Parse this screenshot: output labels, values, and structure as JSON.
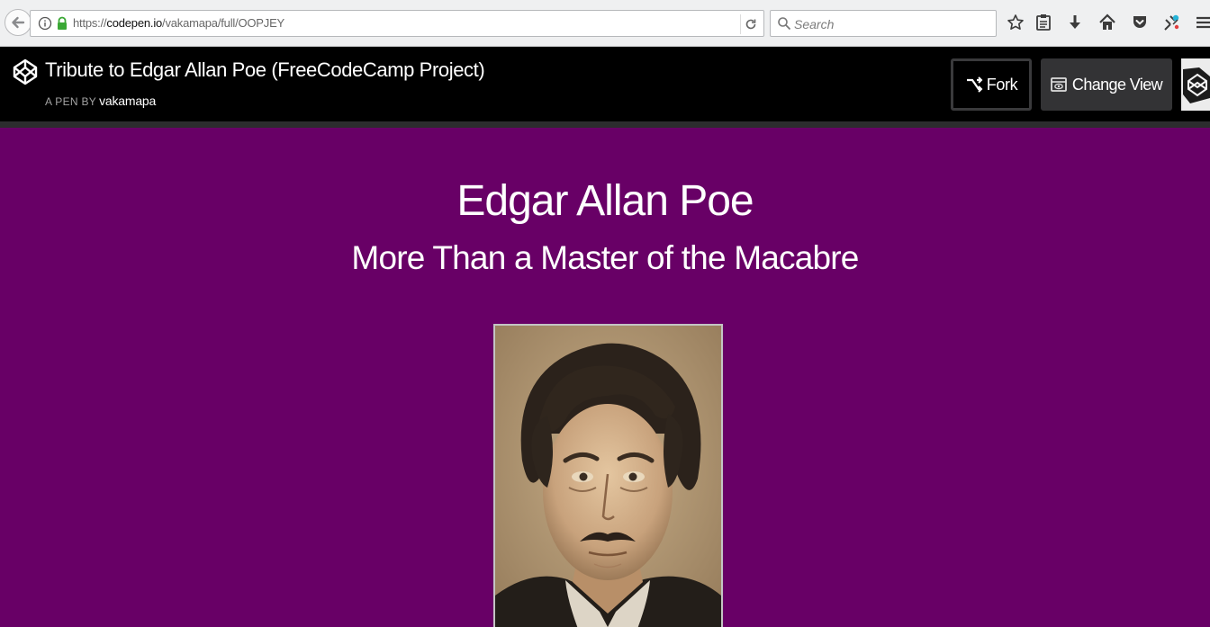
{
  "browser": {
    "url_prefix": "https://",
    "url_domain": "codepen.io",
    "url_path": "/vakamapa/full/OOPJEY",
    "search_placeholder": "Search",
    "toolbar_icons": [
      "bookmark-star-icon",
      "reading-list-icon",
      "download-icon",
      "home-icon",
      "pocket-icon",
      "extension-icon",
      "menu-icon"
    ]
  },
  "codepen": {
    "pen_title": "Tribute to Edgar Allan Poe (FreeCodeCamp Project)",
    "pen_by_label": "A PEN BY",
    "author": "vakamapa",
    "fork_label": "Fork",
    "change_view_label": "Change View"
  },
  "page": {
    "title": "Edgar Allan Poe",
    "subtitle": "More Than a Master of the Macabre",
    "background_color": "#680066"
  }
}
